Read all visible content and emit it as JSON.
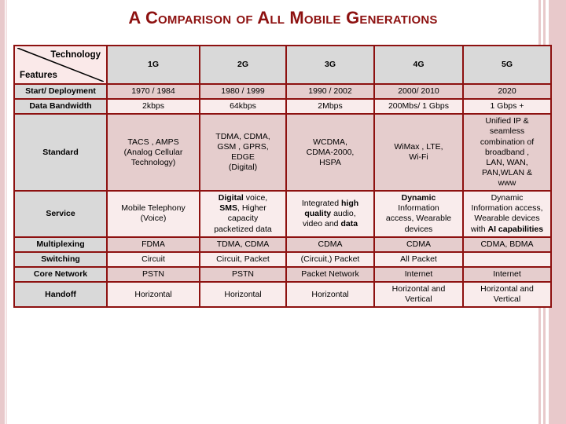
{
  "slide": {
    "title": "A Comparison of All Mobile Generations",
    "title_color": "#8d1110",
    "border_color": "#8d1110",
    "header_bg": "#d9d9d9",
    "row_shade_dark": "#e5cdcd",
    "row_shade_light": "#f9ecec"
  },
  "table": {
    "corner": {
      "top_label": "Technology",
      "bottom_label": "Features"
    },
    "columns": [
      "1G",
      "2G",
      "3G",
      "4G",
      "5G"
    ],
    "rows": [
      {
        "feature": "Start/ Deployment",
        "shade": "dark",
        "cells": [
          {
            "text": "1970 / 1984"
          },
          {
            "text": "1980 / 1999"
          },
          {
            "text": "1990 / 2002"
          },
          {
            "text": "2000/ 2010"
          },
          {
            "text": "2020"
          }
        ]
      },
      {
        "feature": "Data Bandwidth",
        "shade": "light",
        "cells": [
          {
            "text": "2kbps"
          },
          {
            "text": "64kbps"
          },
          {
            "text": "2Mbps"
          },
          {
            "text": "200Mbs/ 1 Gbps"
          },
          {
            "text": "1 Gbps +"
          }
        ]
      },
      {
        "feature": "Standard",
        "shade": "dark",
        "cells": [
          {
            "html": "TACS , AMPS<br>(Analog Cellular<br>Technology)"
          },
          {
            "html": "TDMA, CDMA,<br>GSM , GPRS,<br>EDGE<br>(Digital)"
          },
          {
            "html": "WCDMA,<br>CDMA-2000,<br>HSPA"
          },
          {
            "html": "WiMax , LTE,<br>Wi-Fi"
          },
          {
            "html": "Unified IP &amp;<br>seamless<br>combination of<br>broadband ,<br>LAN, WAN,<br>PAN,WLAN &amp;<br>www"
          }
        ]
      },
      {
        "feature": "Service",
        "shade": "light",
        "cells": [
          {
            "html": "Mobile Telephony<br>(Voice)"
          },
          {
            "html": "<b class=\"em\">Digital</b> voice,<br><b class=\"em\">SMS</b>, Higher<br>capacity<br>packetized data"
          },
          {
            "html": "Integrated <b class=\"em\">high</b><br><b class=\"em\">quality</b> audio,<br>video and <b class=\"em\">data</b>"
          },
          {
            "html": "<b class=\"em\">Dynamic</b><br>Information<br>access, Wearable<br>devices"
          },
          {
            "html": "Dynamic<br>Information access,<br>Wearable devices<br>with <b class=\"em\">AI capabilities</b>"
          }
        ]
      },
      {
        "feature": "Multiplexing",
        "shade": "dark",
        "cells": [
          {
            "text": "FDMA"
          },
          {
            "text": "TDMA, CDMA"
          },
          {
            "text": "CDMA"
          },
          {
            "text": "CDMA"
          },
          {
            "text": "CDMA, BDMA"
          }
        ]
      },
      {
        "feature": "Switching",
        "shade": "light",
        "cells": [
          {
            "text": "Circuit"
          },
          {
            "text": "Circuit, Packet"
          },
          {
            "text": "(Circuit,) Packet"
          },
          {
            "text": "All Packet"
          },
          {
            "text": ""
          }
        ]
      },
      {
        "feature": "Core Network",
        "shade": "dark",
        "cells": [
          {
            "text": "PSTN"
          },
          {
            "text": "PSTN"
          },
          {
            "text": "Packet Network"
          },
          {
            "text": "Internet"
          },
          {
            "text": "Internet"
          }
        ]
      },
      {
        "feature": "Handoff",
        "shade": "light",
        "cells": [
          {
            "text": "Horizontal"
          },
          {
            "text": "Horizontal"
          },
          {
            "text": "Horizontal"
          },
          {
            "html": "Horizontal and<br>Vertical"
          },
          {
            "html": "Horizontal and<br>Vertical"
          }
        ]
      }
    ]
  }
}
